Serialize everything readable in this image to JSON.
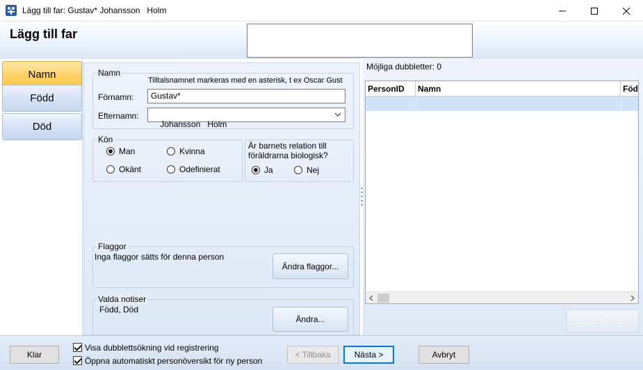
{
  "window": {
    "title": "Lägg till far: Gustav* Johansson   Holm"
  },
  "header": {
    "title": "Lägg till far"
  },
  "nav": {
    "items": [
      {
        "label": "Namn",
        "active": true
      },
      {
        "label": "Född",
        "active": false
      },
      {
        "label": "Död",
        "active": false
      }
    ]
  },
  "name_group": {
    "label": "Namn",
    "hint": "Tilltalsnamnet markeras med en asterisk, t ex  Oscar Gust",
    "firstname_label": "Förnamn:",
    "firstname_value": "Gustav*",
    "lastname_label": "Efternamn:",
    "lastname_value": "Johansson   Holm"
  },
  "gender_group": {
    "label": "Kön",
    "options": [
      "Man",
      "Kvinna",
      "Okänt",
      "Odefinierat"
    ],
    "selected": "Man"
  },
  "relation_group": {
    "label": "Är barnets relation till föräldrarna biologisk?",
    "options": [
      "Ja",
      "Nej"
    ],
    "selected": "Ja"
  },
  "flags_group": {
    "label": "Flaggor",
    "text": "Inga flaggor sätts för denna person",
    "button": "Ändra flaggor..."
  },
  "notices_group": {
    "label": "Valda notiser",
    "text": "Född, Död",
    "button": "Ändra..."
  },
  "duplicates": {
    "label": "Möjliga dubbletter: 0",
    "columns": [
      "PersonID",
      "Namn",
      "Född"
    ],
    "connect_button": "Koppla förälder"
  },
  "bottom": {
    "done_button": "Klar",
    "check1_label": "Visa dubblettsökning vid registrering",
    "check1_checked": true,
    "check2_label": "Öppna automatiskt personöversikt för ny person",
    "check2_checked": true,
    "back_button": "< Tillbaka",
    "next_button": "Nästa >",
    "cancel_button": "Avbryt"
  }
}
